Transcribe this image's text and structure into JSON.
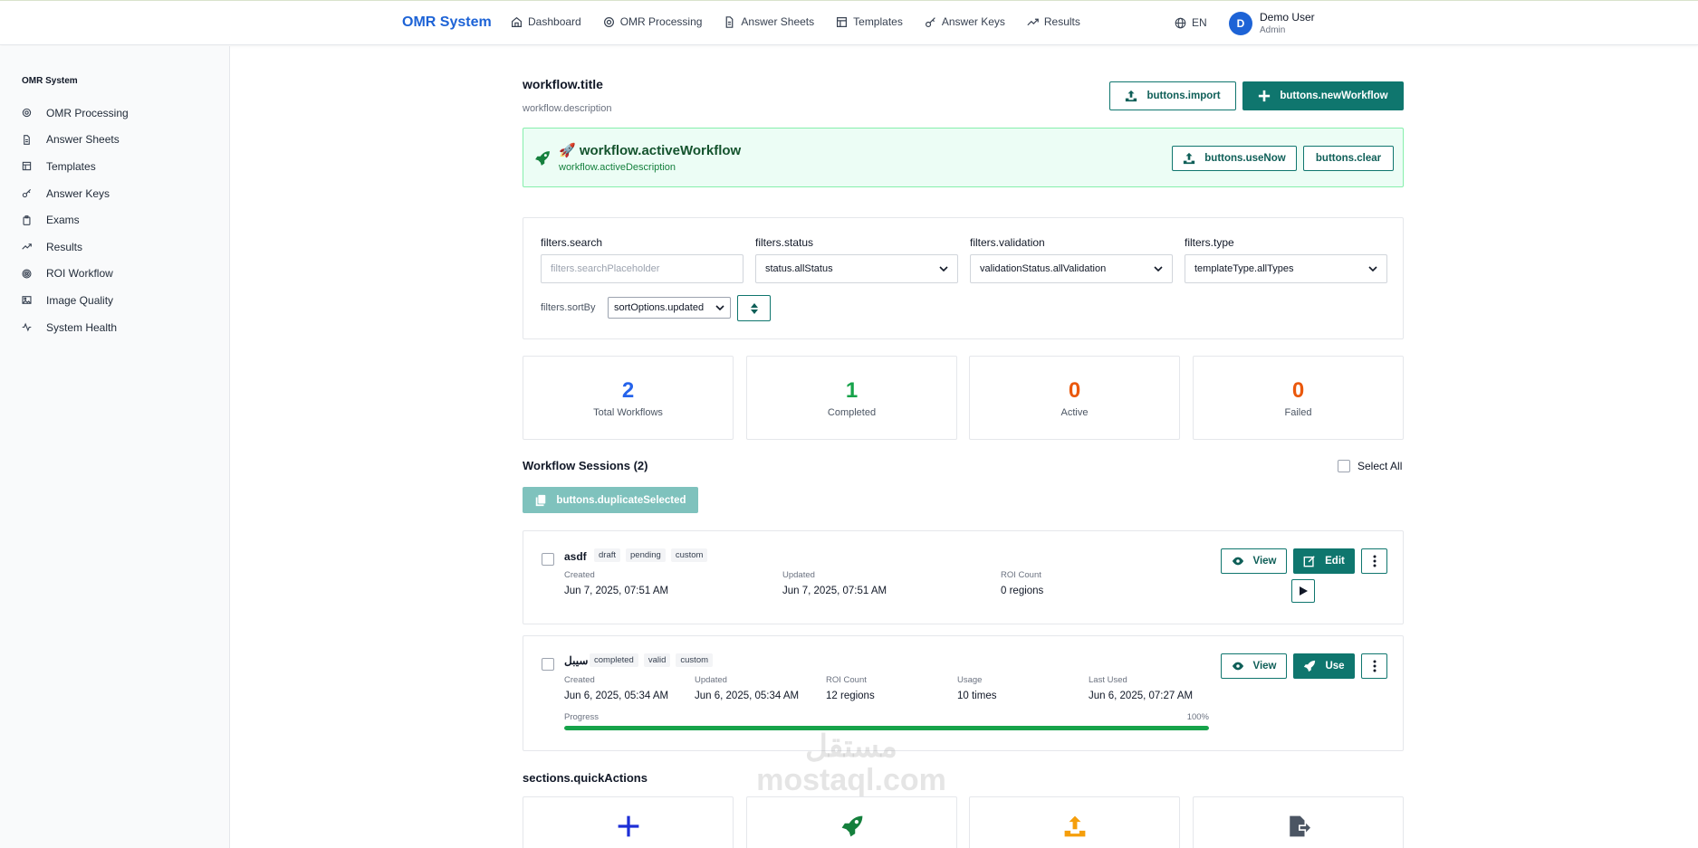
{
  "app": {
    "brand": "OMR System"
  },
  "nav": {
    "items": [
      {
        "label": "Dashboard",
        "icon": "home-icon"
      },
      {
        "label": "OMR Processing",
        "icon": "settings-icon"
      },
      {
        "label": "Answer Sheets",
        "icon": "document-icon"
      },
      {
        "label": "Templates",
        "icon": "template-icon"
      },
      {
        "label": "Answer Keys",
        "icon": "key-icon"
      },
      {
        "label": "Results",
        "icon": "trend-icon"
      }
    ],
    "language": "EN"
  },
  "user": {
    "initial": "D",
    "name": "Demo User",
    "role": "Admin"
  },
  "sidebar": {
    "title": "OMR System",
    "items": [
      {
        "label": "OMR Processing",
        "icon": "settings-icon"
      },
      {
        "label": "Answer Sheets",
        "icon": "document-icon"
      },
      {
        "label": "Templates",
        "icon": "template-icon"
      },
      {
        "label": "Answer Keys",
        "icon": "key-icon"
      },
      {
        "label": "Exams",
        "icon": "clipboard-icon"
      },
      {
        "label": "Results",
        "icon": "trend-icon"
      },
      {
        "label": "ROI Workflow",
        "icon": "target-icon"
      },
      {
        "label": "Image Quality",
        "icon": "image-icon"
      },
      {
        "label": "System Health",
        "icon": "activity-icon"
      }
    ]
  },
  "header": {
    "title": "workflow.title",
    "description": "workflow.description",
    "import_label": "buttons.import",
    "new_label": "buttons.newWorkflow"
  },
  "active": {
    "title": "🚀 workflow.activeWorkflow",
    "description": "workflow.activeDescription",
    "use_now_label": "buttons.useNow",
    "clear_label": "buttons.clear"
  },
  "filters": {
    "search_label": "filters.search",
    "search_placeholder": "filters.searchPlaceholder",
    "status_label": "filters.status",
    "status_value": "status.allStatus",
    "validation_label": "filters.validation",
    "validation_value": "validationStatus.allValidation",
    "type_label": "filters.type",
    "type_value": "templateType.allTypes",
    "sort_label": "filters.sortBy",
    "sort_value": "sortOptions.updated"
  },
  "stats": [
    {
      "value": "2",
      "label": "Total Workflows",
      "color": "#2563eb"
    },
    {
      "value": "1",
      "label": "Completed",
      "color": "#16a34a"
    },
    {
      "value": "0",
      "label": "Active",
      "color": "#ea580c"
    },
    {
      "value": "0",
      "label": "Failed",
      "color": "#ea580c"
    }
  ],
  "sessions": {
    "title": "Workflow Sessions (2)",
    "select_all": "Select All",
    "duplicate_label": "buttons.duplicateSelected",
    "items": [
      {
        "name": "asdf",
        "tags": [
          "draft",
          "pending",
          "custom"
        ],
        "created_k": "Created",
        "created_v": "Jun 7, 2025, 07:51 AM",
        "updated_k": "Updated",
        "updated_v": "Jun 7, 2025, 07:51 AM",
        "roi_k": "ROI Count",
        "roi_v": "0 regions",
        "view_label": "View",
        "edit_label": "Edit"
      },
      {
        "name": "سيبل",
        "tags": [
          "completed",
          "valid",
          "custom"
        ],
        "created_k": "Created",
        "created_v": "Jun 6, 2025, 05:34 AM",
        "updated_k": "Updated",
        "updated_v": "Jun 6, 2025, 05:34 AM",
        "roi_k": "ROI Count",
        "roi_v": "12 regions",
        "usage_k": "Usage",
        "usage_v": "10 times",
        "last_used_k": "Last Used",
        "last_used_v": "Jun 6, 2025, 07:27 AM",
        "progress_k": "Progress",
        "progress_v": "100%",
        "progress": 1.0,
        "view_label": "View",
        "use_label": "Use"
      }
    ]
  },
  "quick_actions": {
    "title": "sections.quickActions",
    "icons": [
      "plus-icon",
      "rocket-icon",
      "upload-icon",
      "export-icon"
    ]
  },
  "watermark": {
    "line1": "مستقل",
    "line2": "mostaql.com"
  },
  "colors": {
    "brand": "#1d63d6",
    "accent": "#0f766e",
    "success": "#16a34a",
    "warning": "#ea580c"
  }
}
